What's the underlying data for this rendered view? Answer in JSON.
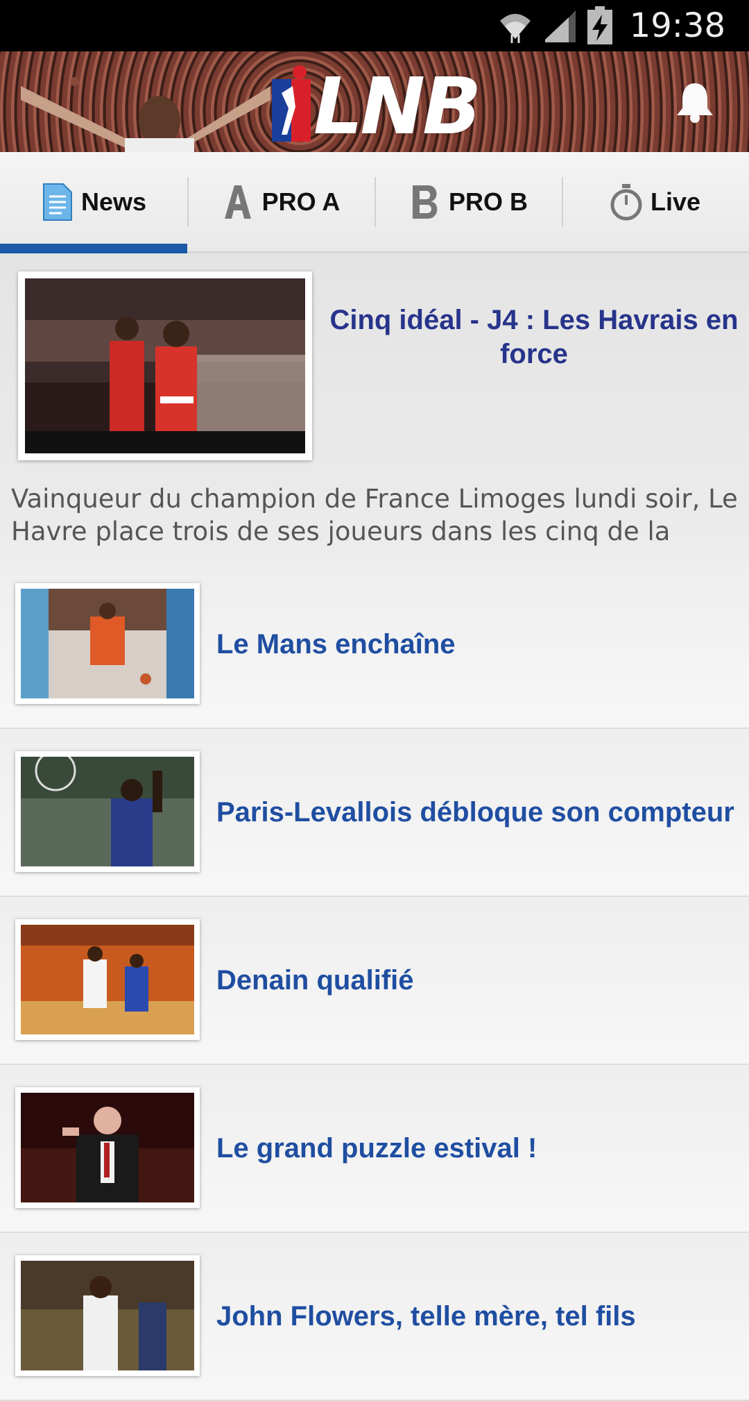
{
  "status_bar": {
    "time": "19:38"
  },
  "header": {
    "logo_text": "LNB"
  },
  "tabs": [
    {
      "label": "News",
      "icon": "news-document-icon",
      "active": true
    },
    {
      "label": "PRO A",
      "icon": "letter-a-icon",
      "active": false
    },
    {
      "label": "PRO B",
      "icon": "letter-b-icon",
      "active": false
    },
    {
      "label": "Live",
      "icon": "stopwatch-icon",
      "active": false
    }
  ],
  "featured": {
    "title": "Cinq idéal - J4 : Les Havrais en force",
    "summary": "Vainqueur du champion de France Limoges lundi soir, Le Havre place trois de ses joueurs dans les cinq de la"
  },
  "articles": [
    {
      "title": "Le Mans enchaîne"
    },
    {
      "title": "Paris-Levallois débloque son compteur"
    },
    {
      "title": "Denain qualifié"
    },
    {
      "title": "Le grand puzzle estival !"
    },
    {
      "title": "John Flowers, telle mère, tel fils"
    }
  ],
  "colors": {
    "tab_indicator": "#1a5aa6",
    "featured_title": "#27348b",
    "article_title": "#1f4ea1",
    "logo_blue": "#1a3f9a",
    "logo_red": "#d8202a"
  }
}
